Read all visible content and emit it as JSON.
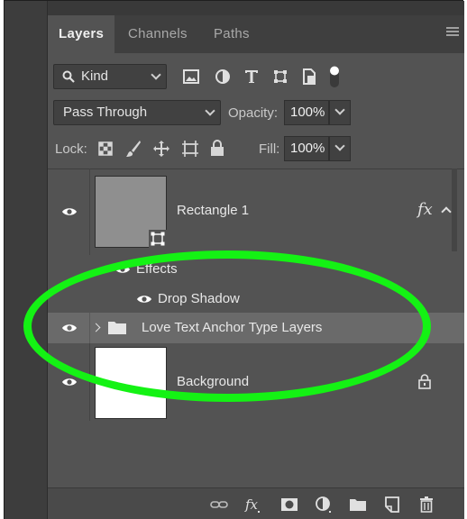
{
  "tabs": [
    {
      "label": "Layers",
      "active": true
    },
    {
      "label": "Channels",
      "active": false
    },
    {
      "label": "Paths",
      "active": false
    }
  ],
  "filter": {
    "kind_label": "Kind"
  },
  "blend": {
    "mode": "Pass Through",
    "opacity_label": "Opacity:",
    "opacity_value": "100%"
  },
  "lock": {
    "label": "Lock:",
    "fill_label": "Fill:",
    "fill_value": "100%"
  },
  "layers": [
    {
      "name": "Rectangle 1",
      "type": "shape",
      "fx": "fx",
      "visible": true
    },
    {
      "name": "Effects",
      "type": "effects-header",
      "visible": true
    },
    {
      "name": "Drop Shadow",
      "type": "effect",
      "visible": true
    },
    {
      "name": "Love Text Anchor Type Layers",
      "type": "group",
      "visible": true,
      "selected": true
    },
    {
      "name": "Background",
      "type": "background",
      "visible": true,
      "locked": true
    }
  ],
  "colors": {
    "panel_bg": "#535353",
    "selected_row": "#6a6a6a",
    "highlight": "#14f214"
  }
}
